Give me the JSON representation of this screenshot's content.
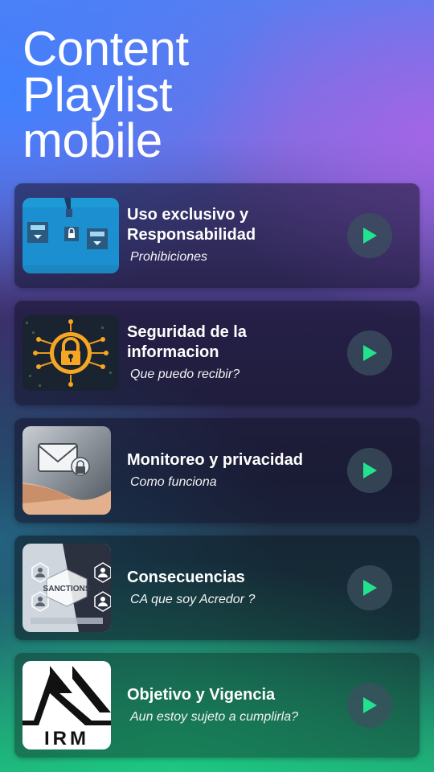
{
  "header": {
    "title_line1": "Content",
    "title_line2": "Playlist",
    "title_line3": "mobile"
  },
  "items": [
    {
      "title": "Uso exclusivo y Responsabilidad",
      "subtitle": "Prohibiciones",
      "thumb_icon": "security-boxes-illustration-icon"
    },
    {
      "title": "Seguridad de la informacion",
      "subtitle": "Que puedo recibir?",
      "thumb_icon": "padlock-circuit-icon"
    },
    {
      "title": "Monitoreo y privacidad",
      "subtitle": "Como funciona",
      "thumb_icon": "envelope-hand-icon"
    },
    {
      "title": "Consecuencias",
      "subtitle": "CA que soy Acredor ?",
      "thumb_icon": "sanctions-network-icon",
      "thumb_text": "SANCTIONS"
    },
    {
      "title": "Objetivo y Vigencia",
      "subtitle": "Aun estoy sujeto a cumplirla?",
      "thumb_icon": "irm-logo-icon",
      "thumb_text": "IRM"
    }
  ],
  "colors": {
    "play_accent": "#22e38d",
    "card_bg": "#1a1830"
  }
}
